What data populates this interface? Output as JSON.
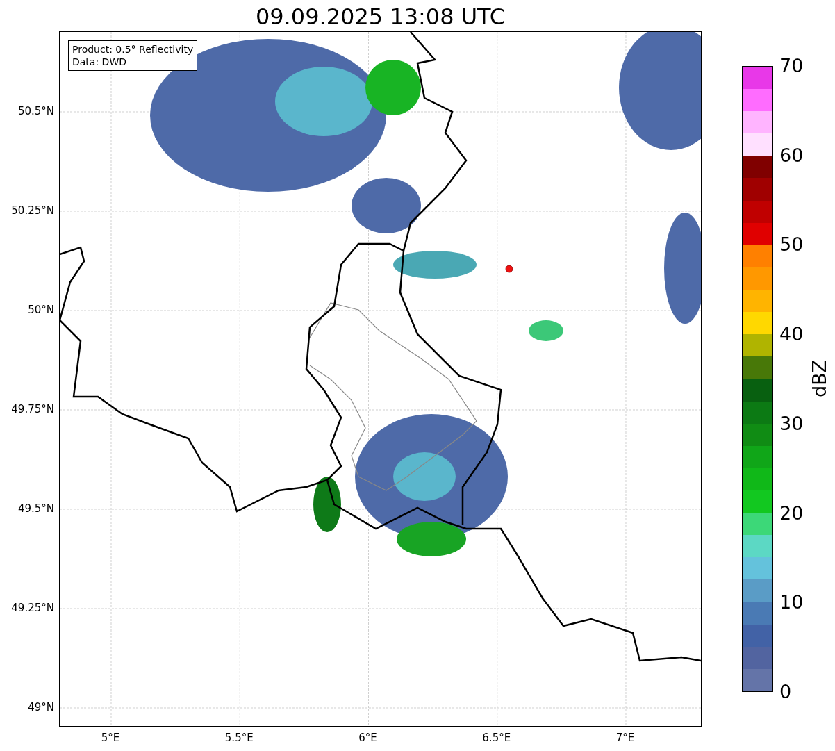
{
  "title": "09.09.2025 13:08 UTC",
  "map": {
    "legend": [
      "Product: 0.5° Reflectivity",
      "Data: DWD"
    ],
    "lat_ticks": [
      "50.5°N",
      "50.25°N",
      "50°N",
      "49.75°N",
      "49.5°N",
      "49.25°N",
      "49°N"
    ],
    "lon_ticks": [
      "5°E",
      "5.5°E",
      "6°E",
      "6.5°E",
      "7°E"
    ]
  },
  "colorbar": {
    "label": "dBZ",
    "ticks": [
      "70",
      "60",
      "50",
      "40",
      "30",
      "20",
      "10",
      "0"
    ],
    "segments": [
      {
        "color": "#6474a8"
      },
      {
        "color": "#5264a0"
      },
      {
        "color": "#4262a6"
      },
      {
        "color": "#4a7ab4"
      },
      {
        "color": "#5a9cc6"
      },
      {
        "color": "#64c2dc"
      },
      {
        "color": "#5cd8c4"
      },
      {
        "color": "#3cd878"
      },
      {
        "color": "#12c820"
      },
      {
        "color": "#10b818"
      },
      {
        "color": "#10a618"
      },
      {
        "color": "#108c14"
      },
      {
        "color": "#0c7a14"
      },
      {
        "color": "#086010"
      },
      {
        "color": "#487808"
      },
      {
        "color": "#b0b400"
      },
      {
        "color": "#ffd800"
      },
      {
        "color": "#ffb400"
      },
      {
        "color": "#ff9800"
      },
      {
        "color": "#ff8000"
      },
      {
        "color": "#e00000"
      },
      {
        "color": "#c00000"
      },
      {
        "color": "#a00000"
      },
      {
        "color": "#800000"
      },
      {
        "color": "#ffe0ff"
      },
      {
        "color": "#ffb4ff"
      },
      {
        "color": "#ff6cff"
      },
      {
        "color": "#e838e8"
      }
    ]
  }
}
